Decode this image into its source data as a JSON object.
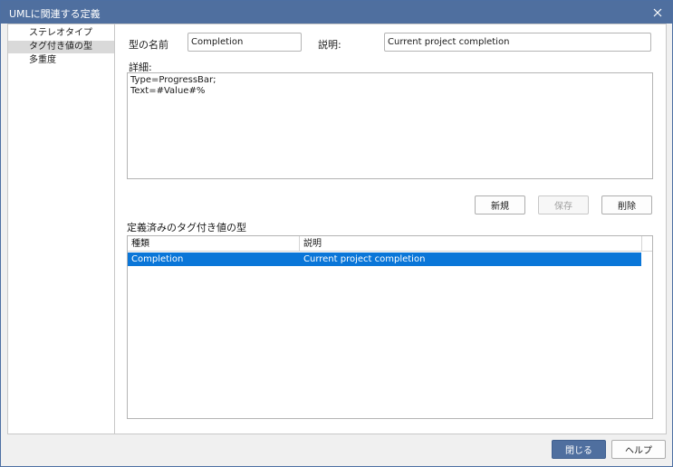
{
  "window": {
    "title": "UMLに関連する定義",
    "close_icon": "close-icon",
    "title_bar_color": "#4f6f9f"
  },
  "nav": {
    "items": [
      {
        "label": "ステレオタイプ",
        "selected": false
      },
      {
        "label": "タグ付き値の型",
        "selected": true
      },
      {
        "label": "多重度",
        "selected": false
      }
    ]
  },
  "form": {
    "type_name_label": "型の名前",
    "type_name_value": "Completion",
    "description_label": "説明:",
    "description_value": "Current project completion",
    "detail_label": "詳細:",
    "detail_value": "Type=ProgressBar;\nText=#Value#%"
  },
  "actions": {
    "new_label": "新規",
    "save_label": "保存",
    "delete_label": "削除"
  },
  "list": {
    "caption": "定義済みのタグ付き値の型",
    "columns": [
      "種類",
      "説明"
    ],
    "rows": [
      {
        "kind": "Completion",
        "description": "Current project completion",
        "selected": true
      }
    ],
    "selection_color": "#0a76d8"
  },
  "footer": {
    "close_label": "閉じる",
    "help_label": "ヘルプ"
  }
}
